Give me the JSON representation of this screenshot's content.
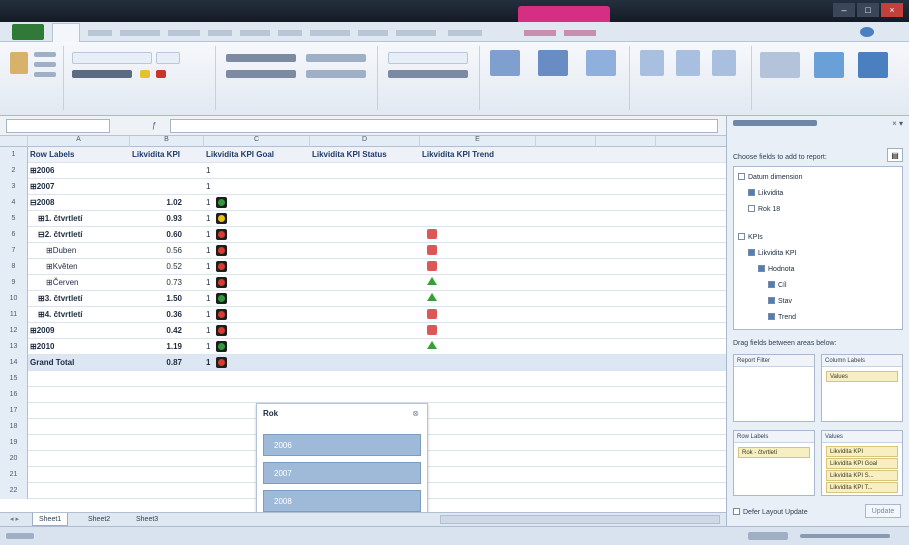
{
  "grid": {
    "columns": [
      "A",
      "B",
      "C",
      "D",
      "E"
    ],
    "rows": [
      {
        "num": "1",
        "label": "Row Labels",
        "kpi": "Likvidita KPI",
        "goal": "Likvidita KPI Goal",
        "status": "Likvidita KPI Status",
        "trend": "Likvidita KPI Trend",
        "header": true
      },
      {
        "num": "2",
        "label": "⊞2006",
        "kpi": "",
        "goal": "1",
        "status": "",
        "trend": ""
      },
      {
        "num": "3",
        "label": "⊞2007",
        "kpi": "",
        "goal": "1",
        "status": "",
        "trend": ""
      },
      {
        "num": "4",
        "label": "⊟2008",
        "kpi": "1.02",
        "goal": "1",
        "status": "green",
        "trend": ""
      },
      {
        "num": "5",
        "label": "⊞1. čtvrtletí",
        "kpi": "0.93",
        "goal": "1",
        "status": "yellow",
        "trend": ""
      },
      {
        "num": "6",
        "label": "⊟2. čtvrtletí",
        "kpi": "0.60",
        "goal": "1",
        "status": "red",
        "trend": "down"
      },
      {
        "num": "7",
        "label": "⊞Duben",
        "kpi": "0.56",
        "goal": "1",
        "status": "red",
        "trend": "down"
      },
      {
        "num": "8",
        "label": "⊞Květen",
        "kpi": "0.52",
        "goal": "1",
        "status": "red",
        "trend": "down"
      },
      {
        "num": "9",
        "label": "⊞Červen",
        "kpi": "0.73",
        "goal": "1",
        "status": "red",
        "trend": "up"
      },
      {
        "num": "10",
        "label": "⊞3. čtvrtletí",
        "kpi": "1.50",
        "goal": "1",
        "status": "green",
        "trend": "up"
      },
      {
        "num": "11",
        "label": "⊞4. čtvrtletí",
        "kpi": "0.36",
        "goal": "1",
        "status": "red",
        "trend": "down"
      },
      {
        "num": "12",
        "label": "⊞2009",
        "kpi": "0.42",
        "goal": "1",
        "status": "red",
        "trend": "down"
      },
      {
        "num": "13",
        "label": "⊞2010",
        "kpi": "1.19",
        "goal": "1",
        "status": "green",
        "trend": "up"
      },
      {
        "num": "14",
        "label": "Grand Total",
        "kpi": "0.87",
        "goal": "1",
        "status": "red",
        "trend": "",
        "total": true
      },
      {
        "num": "15"
      },
      {
        "num": "16"
      },
      {
        "num": "17"
      },
      {
        "num": "18"
      },
      {
        "num": "19"
      },
      {
        "num": "20"
      },
      {
        "num": "21"
      },
      {
        "num": "22"
      }
    ]
  },
  "slicer": {
    "title": "Rok",
    "items": [
      "2006",
      "2007",
      "2008"
    ]
  },
  "pane": {
    "sub": "Choose fields to add to report:",
    "fields": [
      {
        "label": "Datum dimension",
        "indent": 0,
        "checked": false
      },
      {
        "label": "Likvidita",
        "indent": 1,
        "checked": true
      },
      {
        "label": "Rok 18",
        "indent": 1,
        "checked": false
      },
      {
        "label": "KPIs",
        "indent": 0,
        "checked": false
      },
      {
        "label": "Likvidita KPI",
        "indent": 1,
        "checked": true
      },
      {
        "label": "Hodnota",
        "indent": 2,
        "checked": true
      },
      {
        "label": "Cíl",
        "indent": 3,
        "checked": true
      },
      {
        "label": "Stav",
        "indent": 3,
        "checked": true
      },
      {
        "label": "Trend",
        "indent": 3,
        "checked": true
      }
    ],
    "areas_label": "Drag fields between areas below:",
    "report_filter": "Report Filter",
    "column_labels": "Column Labels",
    "row_labels": "Row Labels",
    "values": "Values",
    "col_chip": "Values",
    "row_chip": "Rok - čtvrtletí",
    "value_chips": [
      "Likvidita KPI",
      "Likvidita KPI Goal",
      "Likvidita KPI S...",
      "Likvidita KPI T..."
    ],
    "defer": "Defer Layout Update",
    "update": "Update"
  },
  "sheets": [
    "Sheet1",
    "Sheet2",
    "Sheet3"
  ],
  "colors": {
    "green": "#2e9a3a",
    "yellow": "#e8c21a",
    "red": "#d93a32"
  }
}
